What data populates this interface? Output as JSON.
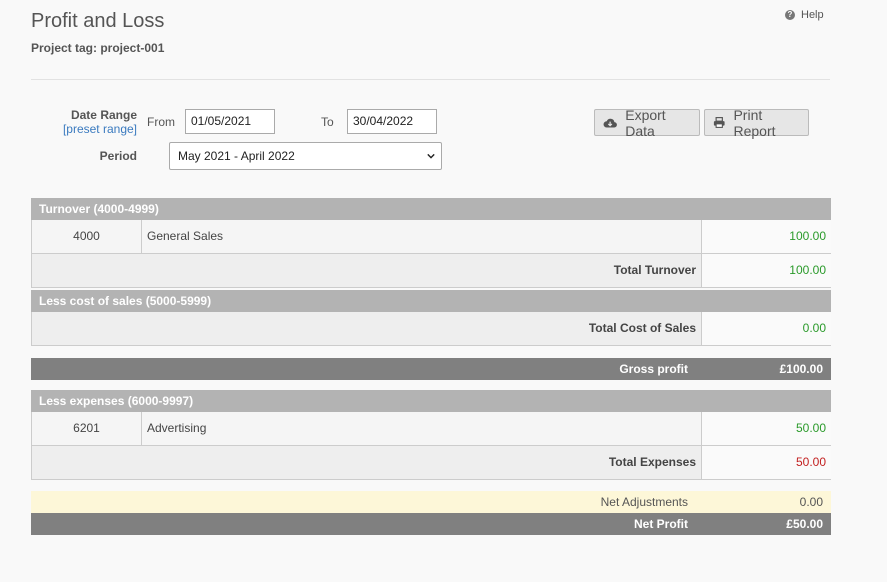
{
  "page": {
    "title": "Profit and Loss",
    "project_tag": "Project tag: project-001",
    "help_label": "Help"
  },
  "filters": {
    "date_range_label": "Date Range",
    "preset_range_link": "[preset range]",
    "from_label": "From",
    "from_value": "01/05/2021",
    "to_label": "To",
    "to_value": "30/04/2022",
    "period_label": "Period",
    "period_selected": "May 2021 - April 2022"
  },
  "actions": {
    "export_label": "Export Data",
    "print_label": "Print Report"
  },
  "turnover": {
    "heading": "Turnover (4000-4999)",
    "rows": [
      {
        "code": "4000",
        "name": "General Sales",
        "amount": "100.00"
      }
    ],
    "total_label": "Total Turnover",
    "total_value": "100.00"
  },
  "cost_of_sales": {
    "heading": "Less cost of sales (5000-5999)",
    "total_label": "Total Cost of Sales",
    "total_value": "0.00"
  },
  "gross_profit": {
    "label": "Gross profit",
    "value": "£100.00"
  },
  "expenses": {
    "heading": "Less expenses (6000-9997)",
    "rows": [
      {
        "code": "6201",
        "name": "Advertising",
        "amount": "50.00"
      }
    ],
    "total_label": "Total Expenses",
    "total_value": "50.00"
  },
  "net_adjustments": {
    "label": "Net Adjustments",
    "value": "0.00"
  },
  "net_profit": {
    "label": "Net Profit",
    "value": "£50.00"
  },
  "colors": {
    "positive": "#2a9a2a",
    "negative": "#c21f1f",
    "section_header": "#b3b3b3",
    "summary_bar": "#808080",
    "adjustment_bar": "#fdf7d8",
    "link": "#3a7abf"
  }
}
